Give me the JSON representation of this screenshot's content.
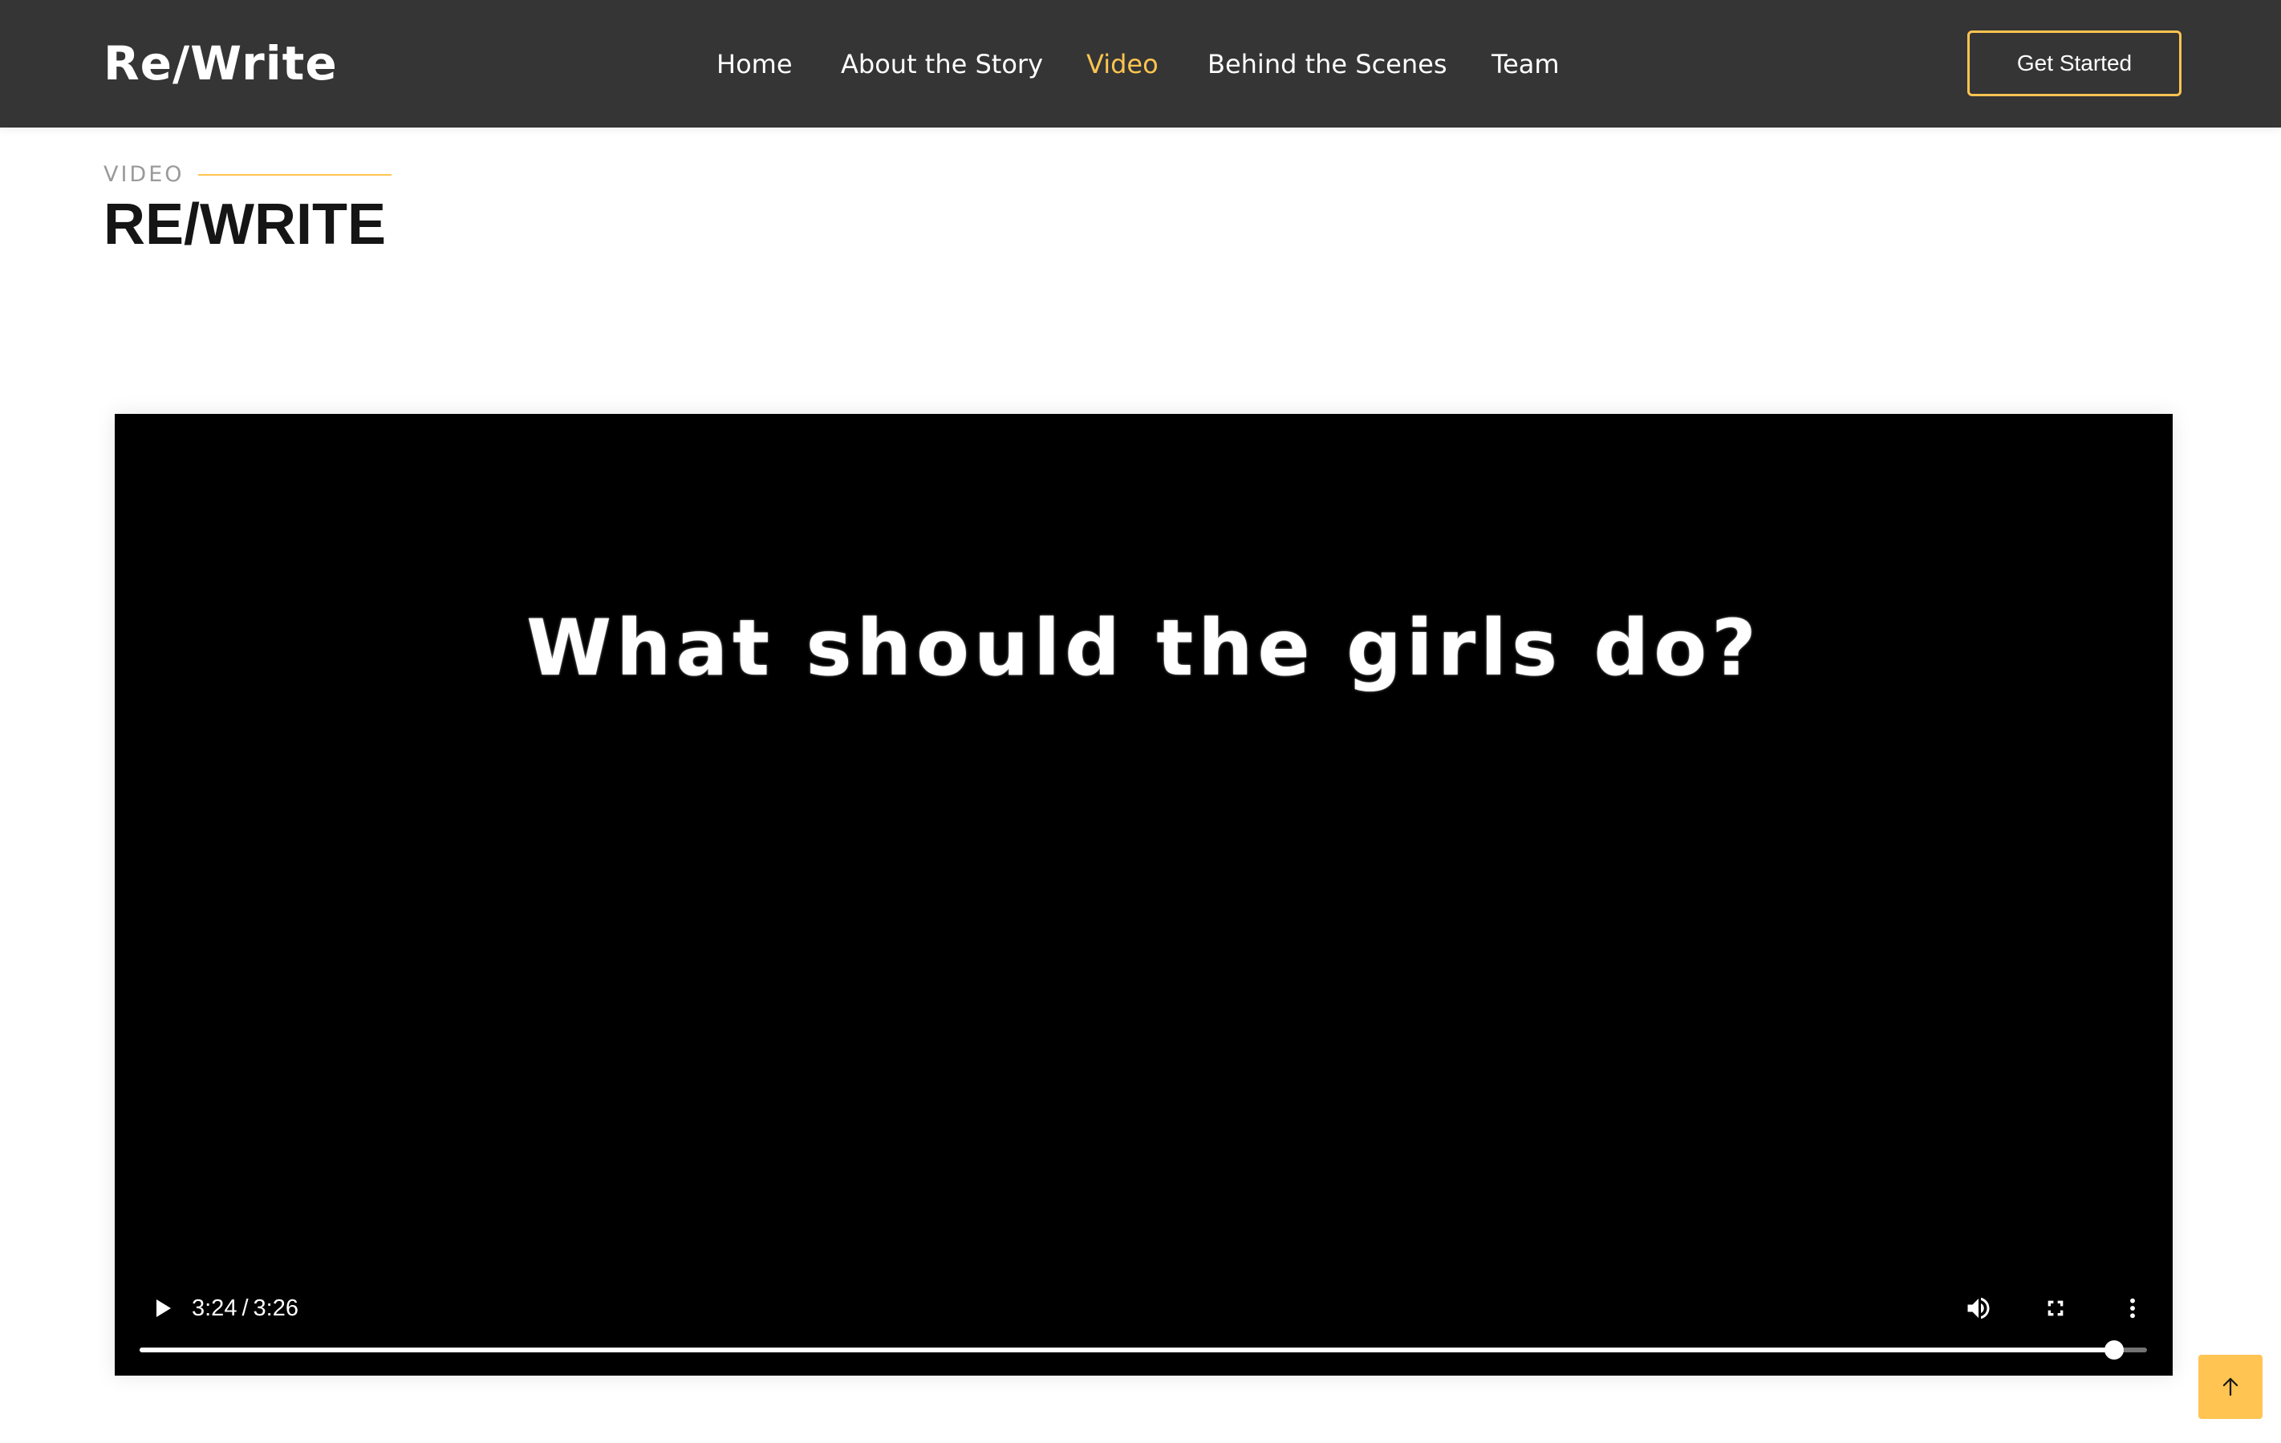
{
  "header": {
    "logo": "Re/Write",
    "nav": [
      {
        "label": "Home"
      },
      {
        "label": "About the Story"
      },
      {
        "label": "Video"
      },
      {
        "label": "Behind the Scenes"
      },
      {
        "label": "Team"
      }
    ],
    "active_nav": "Video",
    "cta_label": "Get Started"
  },
  "section": {
    "eyebrow": "VIDEO",
    "title": "RE/WRITE"
  },
  "video": {
    "caption": "What should the girls do?",
    "current_time": "3:24",
    "separator": "/",
    "duration": "3:26",
    "progress_fraction": 0.9838,
    "icons": {
      "play": "play-icon",
      "volume": "volume-icon",
      "fullscreen": "fullscreen-icon",
      "more": "more-options-icon"
    }
  },
  "back_to_top": {
    "icon": "arrow-up-icon"
  },
  "colors": {
    "header_bg": "#353535",
    "accent": "#ffc451",
    "title_text": "#151515",
    "eyebrow_text": "#9a9a9a",
    "video_bg": "#000000"
  }
}
